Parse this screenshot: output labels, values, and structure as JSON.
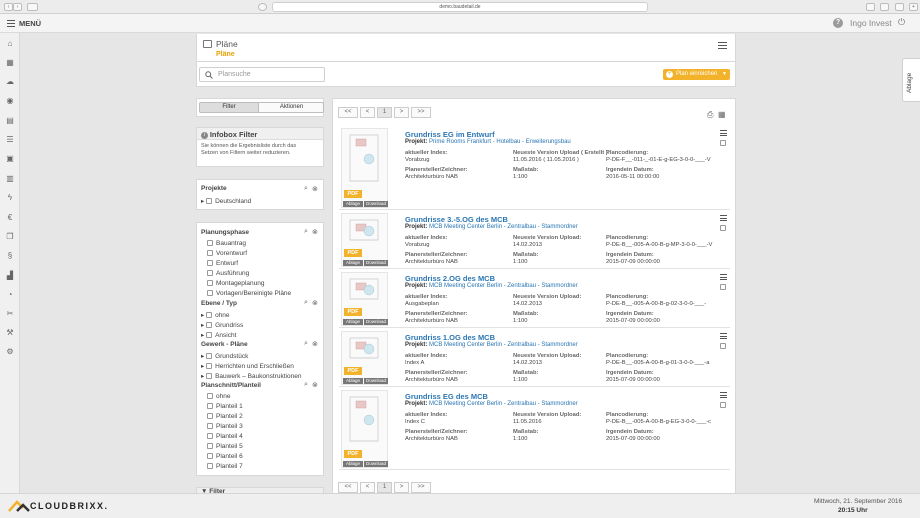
{
  "browser": {
    "url": "demo.baudetail.de"
  },
  "topbar": {
    "menu_label": "MENÜ",
    "user": "Ingo Invest"
  },
  "sidebar_icons": [
    "home-icon",
    "floorplan-icon",
    "chat-icon",
    "camera-icon",
    "document-icon",
    "list-icon",
    "image-icon",
    "calendar-icon",
    "lightning-icon",
    "euro-icon",
    "copy-icon",
    "paragraph-icon",
    "chart-icon",
    "timer-icon",
    "tools-icon",
    "wrench-icon",
    "settings-icon"
  ],
  "header": {
    "title": "Pläne",
    "subtitle": "Pläne"
  },
  "search": {
    "placeholder": "Plansuche"
  },
  "plan_button": {
    "label": "Plan einreichen"
  },
  "ablage_tab": "Ablage",
  "tabs": {
    "filter": "Filter",
    "aktionen": "Aktionen"
  },
  "infobox": {
    "title": "Infobox Filter",
    "text": "Sie können die Ergebnisliste durch das Setzen von Filtern weiter reduzieren."
  },
  "projekte": {
    "title": "Projekte",
    "items": [
      "Deutschland"
    ]
  },
  "planungsphase": {
    "title": "Planungsphase",
    "items": [
      "Bauantrag",
      "Vorentwurf",
      "Entwurf",
      "Ausführung",
      "Montageplanung",
      "Vorlagen/Bereinigte Pläne"
    ]
  },
  "ebene": {
    "title": "Ebene / Typ",
    "items": [
      "ohne",
      "Grundriss",
      "Ansicht"
    ]
  },
  "gewerk": {
    "title": "Gewerk - Pläne",
    "items": [
      "Grundstück",
      "Herrichten und Erschließen",
      "Bauwerk – Baukonstruktionen"
    ]
  },
  "planschnitt": {
    "title": "Planschnitt/Planteil",
    "items": [
      "ohne",
      "Planteil 1",
      "Planteil 2",
      "Planteil 3",
      "Planteil 4",
      "Planteil 5",
      "Planteil 6",
      "Planteil 7"
    ]
  },
  "bottom_filter": "Filter",
  "pager": {
    "first": "<<",
    "prev": "<",
    "page": "1",
    "next": ">",
    "last": ">>"
  },
  "labels": {
    "projekt": "Projekt:",
    "index": "aktueller Index:",
    "version": "Neueste Version Upload:",
    "version_erstellt": "Neueste Version Upload ( Erstellt ):",
    "codierung": "Plancodierung:",
    "ersteller": "Planersteller/Zeichner:",
    "massstab": "Maßstab:",
    "datum": "Irgendein Datum:",
    "pdf": "PDF",
    "ablage": "Ablage",
    "download": "Download"
  },
  "rows": [
    {
      "title": "Grundriss EG im Entwurf",
      "project": "Prime Rooms Frankfurt - Hotelbau - Erweiterungsbau",
      "index": "Vorabzug",
      "version": "11.05.2016 ( 11.05.2016 )",
      "code": "P-DE-F__-011-_-01-E-g-EG-3-0-0-___-V",
      "ersteller": "Architekturbüro NAB",
      "massstab": "1:100",
      "datum": "2016-05-11 00:00:00"
    },
    {
      "title": "Grundrisse 3.-5.OG des MCB",
      "project": "MCB Meeting Center Berlin - Zentralbau - Stammordner",
      "index": "Vorabzug",
      "version": "14.02.2013",
      "code": "P-DE-B__-005-A-00-B-g-MP-3-0-0-___-V",
      "ersteller": "Architekturbüro NAB",
      "massstab": "1:100",
      "datum": "2015-07-09 00:00:00"
    },
    {
      "title": "Grundriss 2.OG des MCB",
      "project": "MCB Meeting Center Berlin - Zentralbau - Stammordner",
      "index": "Ausgabeplan",
      "version": "14.02.2013",
      "code": "P-DE-B__-005-A-00-B-g-02-3-0-0-___-",
      "ersteller": "Architekturbüro NAB",
      "massstab": "1:100",
      "datum": "2015-07-09 00:00:00"
    },
    {
      "title": "Grundriss 1.OG des MCB",
      "project": "MCB Meeting Center Berlin - Zentralbau - Stammordner",
      "index": "Index A",
      "version": "14.02.2013",
      "code": "P-DE-B__-005-A-00-B-g-01-3-0-0-___-a",
      "ersteller": "Architekturbüro NAB",
      "massstab": "1:100",
      "datum": "2015-07-09 00:00:00"
    },
    {
      "title": "Grundriss EG des MCB",
      "project": "MCB Meeting Center Berlin - Zentralbau - Stammordner",
      "index": "Index C",
      "version": "11.05.2016",
      "code": "P-DE-B__-005-A-00-B-g-EG-3-0-0-___-c",
      "ersteller": "Architekturbüro NAB",
      "massstab": "1:100",
      "datum": "2015-07-09 00:00:00"
    }
  ],
  "footer": {
    "logo": "CLOUDBRIXX.",
    "date": "Mittwoch, 21. September 2016",
    "time": "20:15 Uhr"
  },
  "colors": {
    "accent": "#f2b22a",
    "link": "#2a76b4"
  }
}
